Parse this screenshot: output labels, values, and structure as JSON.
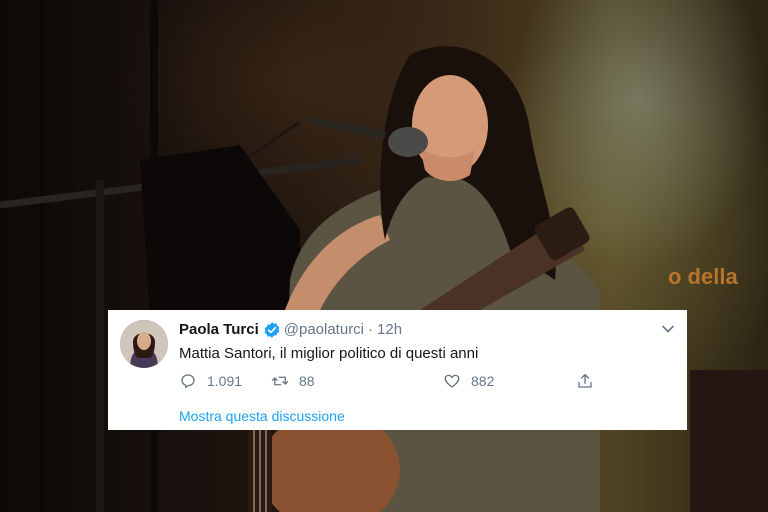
{
  "background": {
    "banner_text": "o della"
  },
  "tweet": {
    "display_name": "Paola Turci",
    "handle": "@paolaturci",
    "separator": "·",
    "time": "12h",
    "verified": true,
    "text": "Mattia Santori, il miglior politico di questi anni",
    "replies": "1.091",
    "retweets": "88",
    "likes": "882",
    "show_thread": "Mostra questa discussione"
  },
  "colors": {
    "accent": "#1da1f2",
    "text_primary": "#14171a",
    "text_secondary": "#657786"
  },
  "icons": {
    "reply": "speech-bubble-icon",
    "retweet": "retweet-arrows-icon",
    "like": "heart-icon",
    "share": "share-arrow-icon",
    "menu": "chevron-down-icon",
    "verified": "verified-badge-icon"
  }
}
